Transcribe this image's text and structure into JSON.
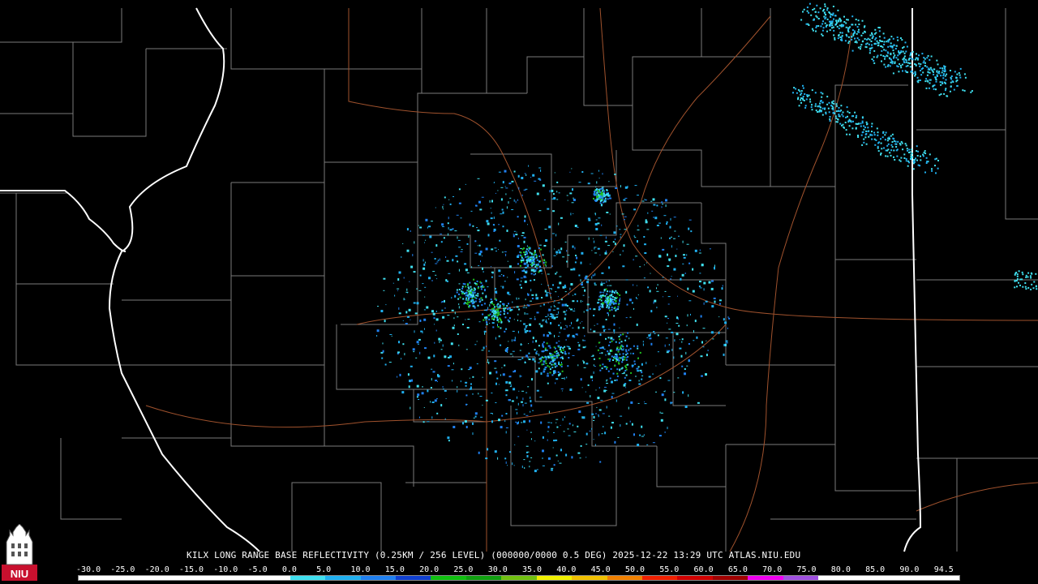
{
  "caption": "KILX LONG RANGE BASE REFLECTIVITY (0.25KM / 256 LEVEL) (000000/0000 0.5 DEG) 2025-12-22 13:29 UTC  ATLAS.NIU.EDU",
  "logo": {
    "text": "NIU",
    "icon": "niu-tower-icon"
  },
  "scale": {
    "labels": [
      "-30.0",
      "-25.0",
      "-20.0",
      "-15.0",
      "-10.0",
      "-5.0",
      "0.0",
      "5.0",
      "10.0",
      "15.0",
      "20.0",
      "25.0",
      "30.0",
      "35.0",
      "40.0",
      "45.0",
      "50.0",
      "55.0",
      "60.0",
      "65.0",
      "70.0",
      "75.0",
      "80.0",
      "85.0",
      "90.0",
      "94.5"
    ],
    "colors": [
      "#ffffff",
      "#ffffff",
      "#ffffff",
      "#ffffff",
      "#ffffff",
      "#ffffff",
      "#40e0f0",
      "#20b0f0",
      "#2080f0",
      "#1040d0",
      "#10c010",
      "#10a010",
      "#70c010",
      "#f0f000",
      "#f0c000",
      "#f08000",
      "#f02000",
      "#d00000",
      "#a00000",
      "#f000f0",
      "#a050e0",
      "#ffffff",
      "#ffffff",
      "#ffffff",
      "#ffffff"
    ]
  }
}
